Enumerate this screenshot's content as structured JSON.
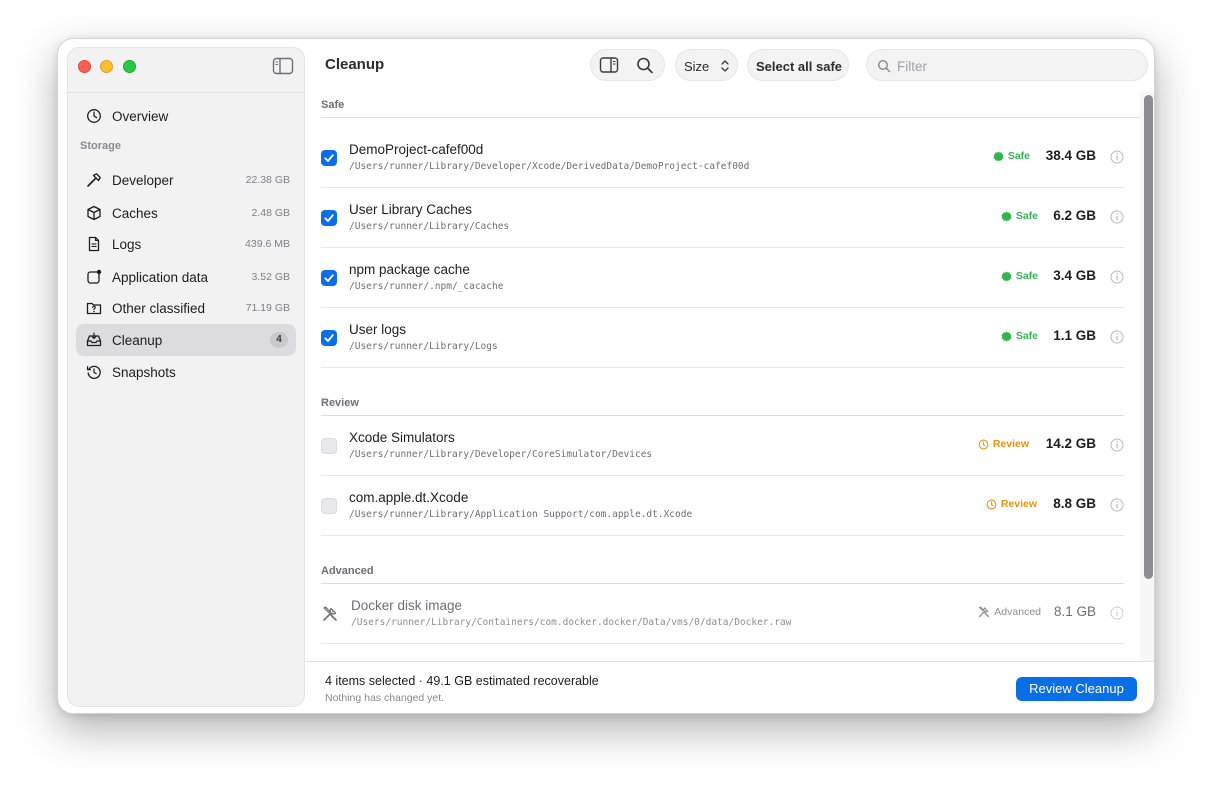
{
  "sidebar": {
    "items": [
      {
        "label": "Overview",
        "icon": "clock-icon"
      },
      {
        "label": "Developer",
        "value": "22.38 GB",
        "icon": "hammer-icon"
      },
      {
        "label": "Caches",
        "value": "2.48 GB",
        "icon": "cube-icon"
      },
      {
        "label": "Logs",
        "value": "439.6 MB",
        "icon": "document-icon"
      },
      {
        "label": "Application data",
        "value": "3.52 GB",
        "icon": "app-data-icon"
      },
      {
        "label": "Other classified",
        "value": "71.19 GB",
        "icon": "question-folder-icon"
      },
      {
        "label": "Cleanup",
        "badge": "4",
        "icon": "tray-icon"
      },
      {
        "label": "Snapshots",
        "icon": "history-icon"
      }
    ],
    "section_label": "Storage"
  },
  "toolbar": {
    "title": "Cleanup",
    "sort_label": "Size",
    "select_safe_label": "Select all safe",
    "filter_placeholder": "Filter"
  },
  "groups": {
    "safe": {
      "label": "Safe",
      "rows": [
        {
          "name": "DemoProject-cafef00d",
          "path": "/Users/runner/Library/Developer/Xcode/DerivedData/DemoProject-cafef00d",
          "status": "Safe",
          "size": "38.4 GB"
        },
        {
          "name": "User Library Caches",
          "path": "/Users/runner/Library/Caches",
          "status": "Safe",
          "size": "6.2 GB"
        },
        {
          "name": "npm package cache",
          "path": "/Users/runner/.npm/_cacache",
          "status": "Safe",
          "size": "3.4 GB"
        },
        {
          "name": "User logs",
          "path": "/Users/runner/Library/Logs",
          "status": "Safe",
          "size": "1.1 GB"
        }
      ]
    },
    "review": {
      "label": "Review",
      "rows": [
        {
          "name": "Xcode Simulators",
          "path": "/Users/runner/Library/Developer/CoreSimulator/Devices",
          "status": "Review",
          "size": "14.2 GB"
        },
        {
          "name": "com.apple.dt.Xcode",
          "path": "/Users/runner/Library/Application Support/com.apple.dt.Xcode",
          "status": "Review",
          "size": "8.8 GB"
        }
      ]
    },
    "advanced": {
      "label": "Advanced",
      "rows": [
        {
          "name": "Docker disk image",
          "path": "/Users/runner/Library/Containers/com.docker.docker/Data/vms/0/data/Docker.raw",
          "status": "Advanced",
          "size": "8.1 GB"
        }
      ]
    }
  },
  "footer": {
    "summary": "4 items selected · 49.1 GB estimated recoverable",
    "sub": "Nothing has changed yet.",
    "button": "Review Cleanup"
  },
  "colors": {
    "accent": "#0a6fe6",
    "safe": "#32b54f",
    "review": "#f0900a"
  }
}
